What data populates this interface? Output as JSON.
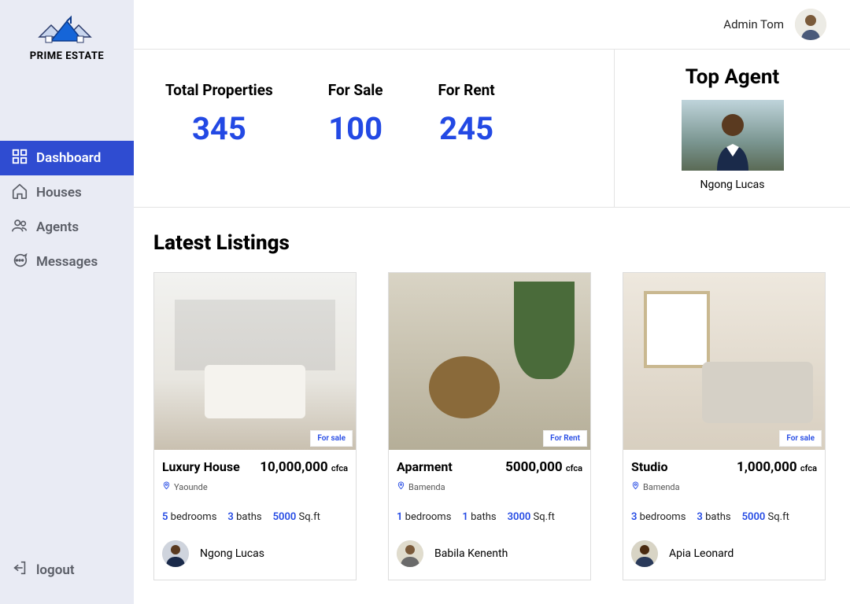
{
  "brand": {
    "name": "PRIME ESTATE"
  },
  "sidebar": {
    "items": [
      {
        "label": "Dashboard"
      },
      {
        "label": "Houses"
      },
      {
        "label": "Agents"
      },
      {
        "label": "Messages"
      }
    ],
    "logout": "logout"
  },
  "user": {
    "name": "Admin Tom"
  },
  "stats": {
    "total": {
      "label": "Total Properties",
      "value": "345"
    },
    "sale": {
      "label": "For Sale",
      "value": "100"
    },
    "rent": {
      "label": "For Rent",
      "value": "245"
    }
  },
  "topAgent": {
    "title": "Top Agent",
    "name": "Ngong Lucas"
  },
  "listings": {
    "title": "Latest Listings",
    "items": [
      {
        "badge": "For sale",
        "title": "Luxury House",
        "price": "10,000,000",
        "currency": "cfca",
        "location": "Yaounde",
        "beds": "5",
        "baths": "3",
        "sqft": "5000",
        "unit": "Sq.ft",
        "agent": "Ngong Lucas",
        "bedLabel": "bedrooms",
        "bathLabel": "baths"
      },
      {
        "badge": "For Rent",
        "title": "Aparment",
        "price": "5000,000",
        "currency": "cfca",
        "location": "Bamenda",
        "beds": "1",
        "baths": "1",
        "sqft": "3000",
        "unit": "Sq.ft",
        "agent": "Babila Kenenth",
        "bedLabel": "bedrooms",
        "bathLabel": "baths"
      },
      {
        "badge": "For sale",
        "title": "Studio",
        "price": "1,000,000",
        "currency": "cfca",
        "location": "Bamenda",
        "beds": "3",
        "baths": "3",
        "sqft": "5000",
        "unit": "Sq.ft",
        "agent": "Apia Leonard",
        "bedLabel": "bedrooms",
        "bathLabel": "baths"
      }
    ]
  }
}
